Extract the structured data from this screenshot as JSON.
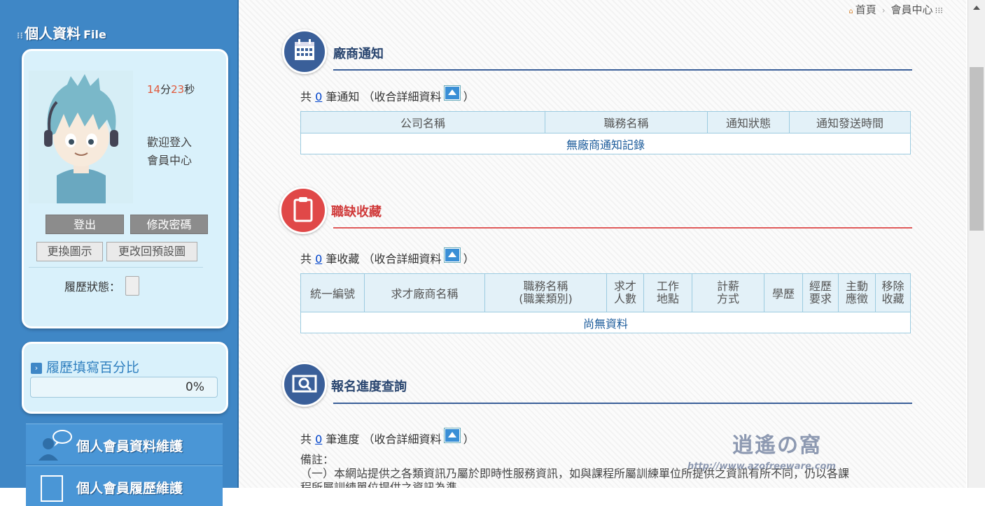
{
  "sidebar": {
    "title": "個人資料",
    "title_en": "File",
    "timer": {
      "min": "14",
      "min_unit": "分",
      "sec": "23",
      "sec_unit": "秒"
    },
    "welcome_line1": "歡迎登入",
    "welcome_line2": "會員中心",
    "logout_label": "登出",
    "change_password_label": "修改密碼",
    "change_icon_label": "更換圖示",
    "reset_icon_label": "更改回預設圖",
    "resume_status_label": "履歷狀態：",
    "progress": {
      "title": "履歷填寫百分比",
      "value_text": "0%",
      "fraction": 0
    },
    "menu": [
      {
        "label": "個人會員資料維護"
      },
      {
        "label": "個人會員履歷維護"
      }
    ]
  },
  "breadcrumb": {
    "home": "首頁",
    "current": "會員中心"
  },
  "sections": {
    "notifications": {
      "title": "廠商通知",
      "count_prefix": "共",
      "count": "0",
      "count_suffix": "筆通知",
      "collapse_label": "（收合詳細資料",
      "close_paren": "）",
      "headers": [
        "公司名稱",
        "職務名稱",
        "通知狀態",
        "通知發送時間"
      ],
      "empty_text": "無廠商通知記錄"
    },
    "favorites": {
      "title": "職缺收藏",
      "count_prefix": "共",
      "count": "0",
      "count_suffix": "筆收藏",
      "collapse_label": "（收合詳細資料",
      "close_paren": "）",
      "headers": [
        [
          "統一編號"
        ],
        [
          "求才廠商名稱"
        ],
        [
          "職務名稱",
          "(職業類別)"
        ],
        [
          "求才",
          "人數"
        ],
        [
          "工作",
          "地點"
        ],
        [
          "計薪",
          "方式"
        ],
        [
          "學歷"
        ],
        [
          "經歷",
          "要求"
        ],
        [
          "主動",
          "應徵"
        ],
        [
          "移除",
          "收藏"
        ]
      ],
      "empty_text": "尚無資料"
    },
    "progress_query": {
      "title": "報名進度查詢",
      "count_prefix": "共",
      "count": "0",
      "count_suffix": "筆進度",
      "collapse_label": "（收合詳細資料",
      "close_paren": "）"
    }
  },
  "notes": {
    "heading": "備註：",
    "line1": "（一）本網站提供之各類資訊乃屬於即時性服務資訊，如與課程所屬訓練單位所提供之資訊有所不同，仍以各課",
    "line2": "程所屬訓練單位提供之資訊為準。"
  },
  "watermark": {
    "text": "逍遙の窩",
    "url": "http://www.azofreeware.com"
  },
  "colors": {
    "sidebar": "#3f87c6",
    "accent_red": "#e05a5a",
    "accent_blue": "#3a5f99",
    "link": "#0044cc"
  }
}
